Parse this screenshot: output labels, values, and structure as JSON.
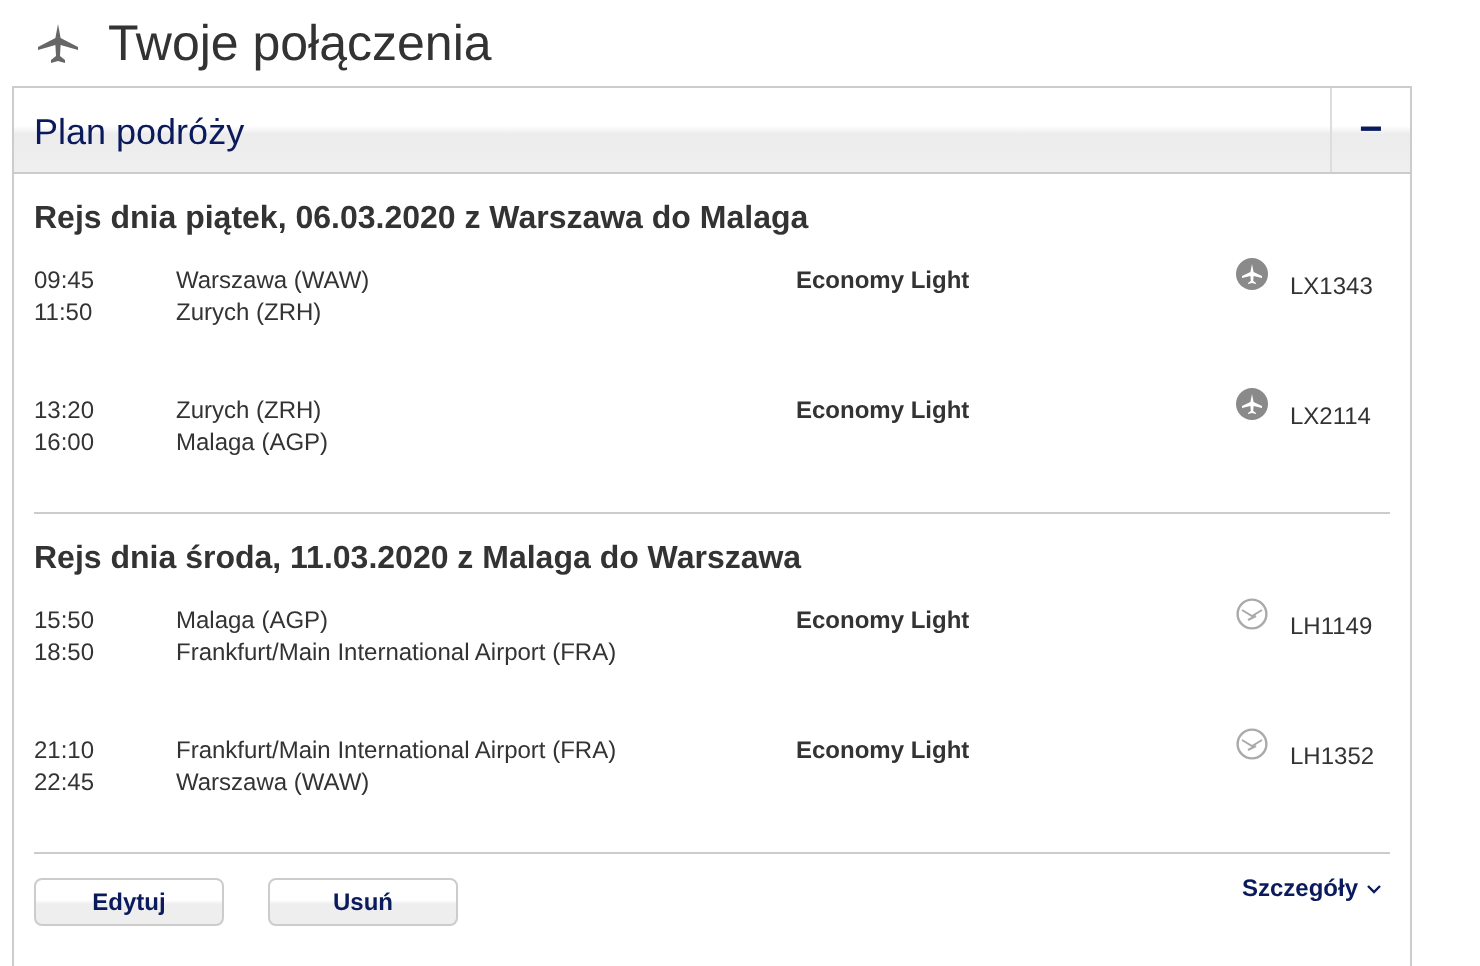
{
  "page_title": "Twoje połączenia",
  "panel": {
    "title": "Plan podróży",
    "collapse_label": "−",
    "expanded": true,
    "journeys": [
      {
        "heading": "Rejs dnia piątek, 06.03.2020 z Warszawa do Malaga",
        "segments": [
          {
            "departure_time": "09:45",
            "arrival_time": "11:50",
            "from": "Warszawa (WAW)",
            "to": "Zurych (ZRH)",
            "fare": "Economy Light",
            "kind": "filled",
            "flight": "LX1343"
          },
          {
            "departure_time": "13:20",
            "arrival_time": "16:00",
            "from": "Zurych (ZRH)",
            "to": "Malaga (AGP)",
            "fare": "Economy Light",
            "kind": "filled",
            "flight": "LX2114"
          }
        ]
      },
      {
        "heading": "Rejs dnia środa, 11.03.2020 z Malaga do Warszawa",
        "segments": [
          {
            "departure_time": "15:50",
            "arrival_time": "18:50",
            "from": "Malaga (AGP)",
            "to": "Frankfurt/Main International Airport (FRA)",
            "fare": "Economy Light",
            "kind": "outline",
            "flight": "LH1149"
          },
          {
            "departure_time": "21:10",
            "arrival_time": "22:45",
            "from": "Frankfurt/Main International Airport (FRA)",
            "to": "Warszawa (WAW)",
            "fare": "Economy Light",
            "kind": "outline",
            "flight": "LH1352"
          }
        ]
      }
    ],
    "buttons": [
      "Edytuj",
      "Usuń"
    ],
    "details_link": "Szczegóły"
  }
}
